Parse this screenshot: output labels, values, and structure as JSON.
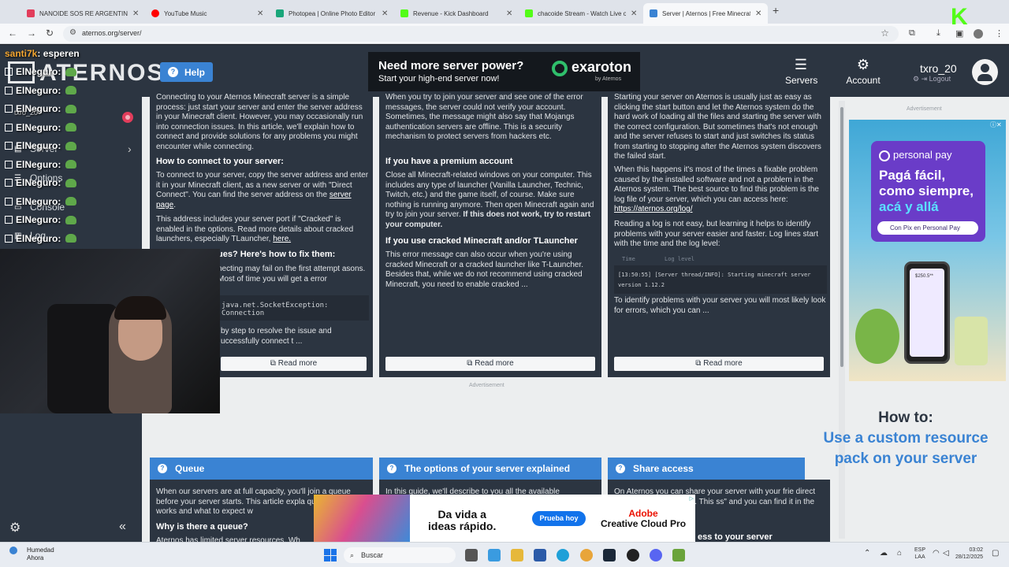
{
  "browser": {
    "tabs": [
      {
        "title": "NANOIDE SOS RE ARGENTINO",
        "color": "#e23d5b"
      },
      {
        "title": "YouTube Music",
        "color": "#ff0000"
      },
      {
        "title": "Photopea | Online Photo Editor",
        "color": "#19a67a"
      },
      {
        "title": "Revenue - Kick Dashboard",
        "color": "#53fc18"
      },
      {
        "title": "chacoide Stream - Watch Live o",
        "color": "#53fc18"
      },
      {
        "title": "Server | Aternos | Free Minecraf",
        "color": "#3a83d3"
      }
    ],
    "new_tab": "+",
    "url": "aternos.org/server/"
  },
  "header": {
    "logo": "ATERNOS",
    "help": "Help",
    "promo": {
      "title": "Need more server power?",
      "subtitle": "Start your high-end server now!",
      "brand": "exaroton",
      "by": "by Aternos"
    },
    "servers": "Servers",
    "account": "Account",
    "username": "txro_20",
    "logout": "Logout"
  },
  "sidebar": {
    "items": [
      "Server",
      "Options",
      "Console",
      "Log"
    ]
  },
  "chat": {
    "top_user": "santi7k",
    "top_message": ": esperen",
    "user": "ElNeguro",
    "colon": " :",
    "line_count": 10
  },
  "cards": [
    {
      "intro": "Connecting to your Aternos Minecraft server is a simple process: just start your server and enter the server address in your Minecraft client. However, you may occasionally run into connection issues. In this article, we'll explain how to connect and provide solutions for any problems you might encounter while connecting.",
      "heading": "How to connect to your server:",
      "body1": "To connect to your server, copy the server address and enter it in your Minecraft client, as a new server or with \"Direct Connect\". You can find the server address on the",
      "link1": "server page",
      "body2": "This address includes your server port if \"Cracked\" is enabled in the options. Read more details about cracked launchers, especially TLauncher,",
      "link2": "here.",
      "heading2": "ues? Here's how to fix them:",
      "body3": "necting may fail on the first attempt asons. Most of time you will get a error",
      "code": "java.net.SocketException: Connection",
      "body4": "by step to resolve the issue and uccessfully connect t ...",
      "readmore": "Read more"
    },
    {
      "intro": "When you try to join your server and see one of the error messages, the server could not verify your account. Sometimes, the message might also say that Mojangs authentication servers are offline. This is a security mechanism to protect servers from hackers etc.",
      "heading": "If you have a premium account",
      "body1": "Close all Minecraft-related windows on your computer. This includes any type of launcher (Vanilla Launcher, Technic, Twitch, etc.) and the game itself, of course. Make sure nothing is running anymore. Then open Minecraft again and try to join your server.",
      "body1_bold": "If this does not work, try to restart your computer.",
      "heading2": "If you use cracked Minecraft and/or TLauncher",
      "body2": "This error message can also occur when you're using cracked Minecraft or a cracked launcher like T-Launcher. Besides that, while we do not recommend using cracked Minecraft, you need to enable cracked ...",
      "readmore": "Read more"
    },
    {
      "intro": "Starting your server on Aternos is usually just as easy as clicking the start button and let the Aternos system do the hard work of loading all the files and starting the server with the correct configuration. But sometimes that's not enough and the server refuses to start and just switches its status from starting to stopping after the Aternos system discovers the failed start.",
      "body1": "When this happens it's most of the times a fixable problem caused by the installed software and not a problem in the Aternos system. The best source to find this problem is the log file of your server, which you can access here:",
      "link1": "https://aternos.org/log/",
      "body2": "Reading a log is not easy, but learning it helps to identify problems with your server easier and faster. Log lines start with the time and the log level:",
      "code_time": "Time",
      "code_level": "Log level",
      "code_line1": "[13:50:55] [Server thread/INFO]: Starting minecraft server",
      "code_line2": "version 1.12.2",
      "body3": "To identify problems with your server you will most likely look for errors, which you can ...",
      "readmore": "Read more"
    }
  ],
  "advertisement_label": "Advertisement",
  "howto": {
    "line1": "How to:",
    "line2": "Use a custom resource",
    "line3": "pack on your server"
  },
  "bottom_cards": [
    {
      "title": "Queue",
      "text": "When our servers are at full capacity, you'll join a queue before your server starts. This article expla queue system works and what to expect w",
      "sub": "Why is there a queue?",
      "sub2": "Aternos has limited server resources. Wh"
    },
    {
      "title": "The options of your server explained",
      "text": "In this guide, we'll describe to you all the available"
    },
    {
      "title": "Share access",
      "text": "On Aternos you can share your server with your frie direct access to your account. This ss\" and you can find it in the vigation.",
      "sub": "ess to your server"
    }
  ],
  "ads": {
    "personal_pay": {
      "brand": "personal pay",
      "line1": "Pagá fácil,",
      "line2": "como siempre,",
      "line3": "acá y allá",
      "pill": "Con Pix en Personal Pay",
      "phone_amount": "$250.5**"
    },
    "adobe": {
      "line1": "Da vida a",
      "line2": "ideas rápido.",
      "button": "Prueba hoy",
      "brand1": "Adobe",
      "brand2": "Creative Cloud Pro"
    }
  },
  "overlay": {
    "k_logo": "K",
    "cam_label": "txro_20"
  },
  "taskbar": {
    "weather_title": "Humedad",
    "weather_sub": "Ahora",
    "search": "Buscar",
    "lang1": "ESP",
    "lang2": "LAA",
    "time": "03:02",
    "date": "28/12/2025"
  }
}
